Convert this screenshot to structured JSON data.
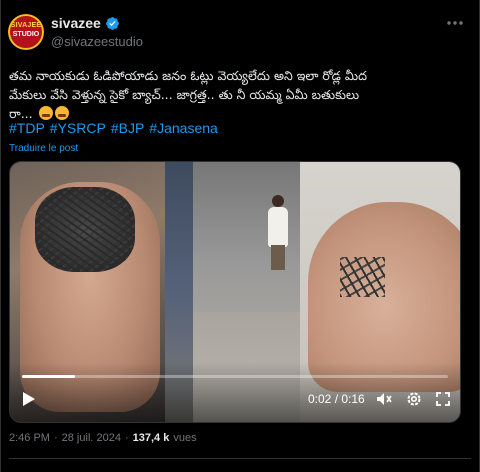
{
  "author": {
    "display_name": "sivazee",
    "handle": "@sivazeestudio",
    "avatar_text_top": "SIVAJEE",
    "avatar_text_bottom": "STUDIO",
    "verified": true
  },
  "tweet": {
    "text_lines": [
      "తమ నాయకుడు ఓడిపోయాడు జనం ఓట్లు వెయ్యలేదు అని ఇలా రోడ్ల మీద",
      "మేకులు వేసి వెళ్తున్న సైకో బ్యాచ్... జాగ్రత్త.. తు నీ యమ్మ ఏమీ బతుకులు",
      "రా..."
    ],
    "hashtags": [
      "#TDP",
      "#YSRCP",
      "#BJP",
      "#Janasena"
    ],
    "translate_label": "Traduire le post"
  },
  "video": {
    "current_time": "0:02",
    "duration": "0:16",
    "time_display": "0:02 / 0:16",
    "progress_fraction": 0.125
  },
  "footer": {
    "time": "2:46 PM",
    "date": "28 juil. 2024",
    "views_count": "137,4 k",
    "views_label": "vues"
  },
  "colors": {
    "accent": "#1d9bf0",
    "background": "#000000",
    "text_primary": "#e7e9ea",
    "text_secondary": "#71767b"
  },
  "icons": [
    "verified-badge-icon",
    "more-options-icon",
    "play-icon",
    "mute-icon",
    "settings-icon",
    "fullscreen-icon"
  ]
}
